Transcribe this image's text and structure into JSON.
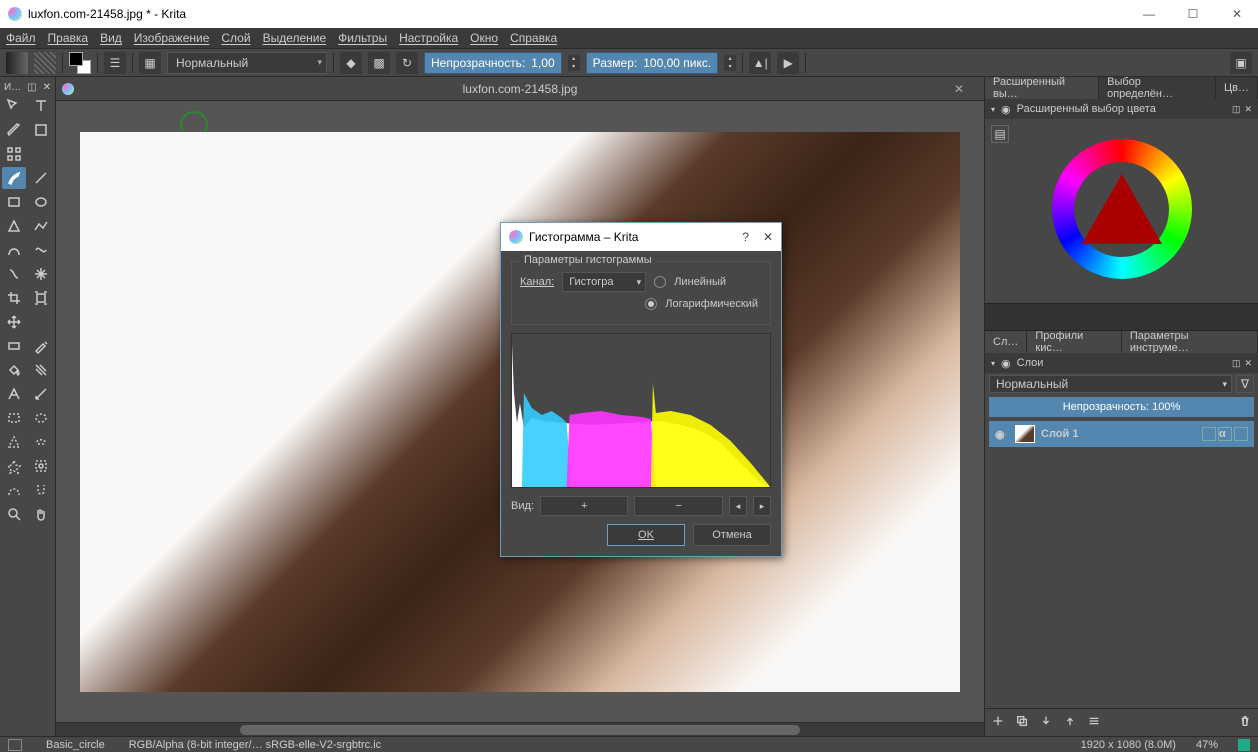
{
  "titlebar": {
    "title": "luxfon.com-21458.jpg * - Krita"
  },
  "menubar": [
    "Файл",
    "Правка",
    "Вид",
    "Изображение",
    "Слой",
    "Выделение",
    "Фильтры",
    "Настройка",
    "Окно",
    "Справка"
  ],
  "toolbar": {
    "blend_mode": "Нормальный",
    "opacity_label": "Непрозрачность:",
    "opacity_value": "1,00",
    "size_label": "Размер:",
    "size_value": "100,00 пикс."
  },
  "doc_tab": "luxfon.com-21458.jpg",
  "right": {
    "tabs1": [
      "Расширенный вы…",
      "Выбор определён…",
      "Цв…"
    ],
    "color_panel_title": "Расширенный выбор цвета",
    "tabs2": [
      "Сл…",
      "Профили кис…",
      "Параметры инструме…"
    ],
    "layers_title": "Слои",
    "layers_mode": "Нормальный",
    "layers_opacity": "Непрозрачность: 100%",
    "layer1": "Слой 1"
  },
  "dialog": {
    "title": "Гистограмма – Krita",
    "group_title": "Параметры гистограммы",
    "channel_label": "Канал:",
    "channel_value": "Гистогра",
    "radio_linear": "Линейный",
    "radio_log": "Логарифмический",
    "view_label": "Вид:",
    "plus": "+",
    "minus": "−",
    "ok": "OK",
    "cancel": "Отмена"
  },
  "status": {
    "brush": "Basic_circle",
    "colorspace": "RGB/Alpha (8-bit integer/… sRGB-elle-V2-srgbtrc.ic",
    "dims": "1920 x 1080 (8.0M)",
    "zoom": "47%"
  },
  "toolbox_title": "И…"
}
